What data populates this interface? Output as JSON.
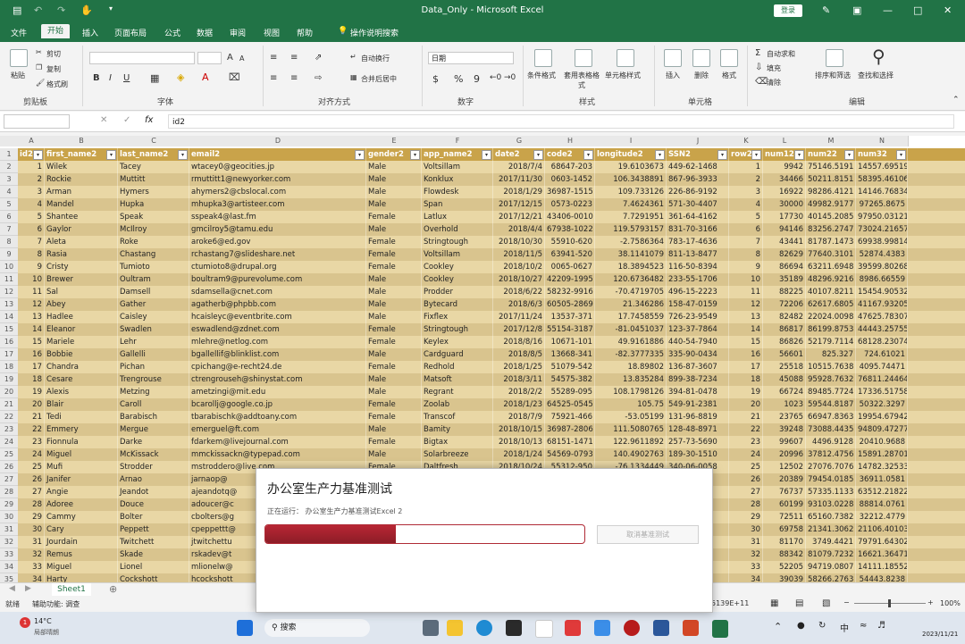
{
  "window": {
    "title": "Data_Only - Microsoft Excel",
    "login_label": "登录"
  },
  "tabs": [
    "文件",
    "开始",
    "插入",
    "页面布局",
    "公式",
    "数据",
    "审阅",
    "视图",
    "帮助",
    "操作说明搜索"
  ],
  "active_tab": "开始",
  "ribbon": {
    "clipboard": {
      "label": "剪贴板",
      "paste": "粘贴",
      "cut": "剪切",
      "copy": "复制",
      "format_painter": "格式刷"
    },
    "font": {
      "label": "字体",
      "size_up": "A",
      "size_down": "A",
      "bold": "B",
      "italic": "I",
      "underline": "U"
    },
    "alignment": {
      "label": "对齐方式",
      "wrap": "自动换行",
      "merge": "合并后居中"
    },
    "number": {
      "label": "数字",
      "format": "日期",
      "currency": "$",
      "percent": "%",
      "comma": "9"
    },
    "styles": {
      "label": "样式",
      "cond": "条件格式",
      "table": "套用表格格式",
      "cell": "单元格样式"
    },
    "cells": {
      "label": "单元格",
      "insert": "插入",
      "delete": "删除",
      "format": "格式"
    },
    "editing": {
      "label": "编辑",
      "autosum": "自动求和",
      "fill": "填充",
      "clear": "清除",
      "sort": "排序和筛选",
      "find": "查找和选择"
    }
  },
  "formula_bar": {
    "name_box": "",
    "fx": "fx",
    "value": "id2"
  },
  "columns": [
    "A",
    "B",
    "C",
    "D",
    "E",
    "F",
    "G",
    "H",
    "I",
    "J",
    "K",
    "L",
    "M",
    "N"
  ],
  "headers": [
    "id2",
    "first_name2",
    "last_name2",
    "email2",
    "gender2",
    "app_name2",
    "date2",
    "code2",
    "longitude2",
    "SSN2",
    "row2",
    "num12",
    "num22",
    "num32"
  ],
  "rows": [
    [
      "1",
      "Wilek",
      "Tacey",
      "wtacey0@geocities.jp",
      "Male",
      "Voltsillam",
      "2018/7/4",
      "68647-203",
      "19.6103673",
      "449-62-1468",
      "1",
      "9942",
      "75146.5191",
      "14557.69519"
    ],
    [
      "2",
      "Rockie",
      "Muttitt",
      "rmuttitt1@newyorker.com",
      "Male",
      "Konklux",
      "2017/11/30",
      "0603-1452",
      "106.3438891",
      "867-96-3933",
      "2",
      "34466",
      "50211.8151",
      "58395.46106"
    ],
    [
      "3",
      "Arman",
      "Hymers",
      "ahymers2@cbslocal.com",
      "Male",
      "Flowdesk",
      "2018/1/29",
      "36987-1515",
      "109.733126",
      "226-86-9192",
      "3",
      "16922",
      "98286.4121",
      "14146.76834"
    ],
    [
      "4",
      "Mandel",
      "Hupka",
      "mhupka3@artisteer.com",
      "Male",
      "Span",
      "2017/12/15",
      "0573-0223",
      "7.4624361",
      "571-30-4407",
      "4",
      "30000",
      "49982.9177",
      "97265.8675"
    ],
    [
      "5",
      "Shantee",
      "Speak",
      "sspeak4@last.fm",
      "Female",
      "Latlux",
      "2017/12/21",
      "43406-0010",
      "7.7291951",
      "361-64-4162",
      "5",
      "17730",
      "40145.2085",
      "97950.03121"
    ],
    [
      "6",
      "Gaylor",
      "McIlroy",
      "gmcilroy5@tamu.edu",
      "Male",
      "Overhold",
      "2018/4/4",
      "67938-1022",
      "119.5793157",
      "831-70-3166",
      "6",
      "94146",
      "83256.2747",
      "73024.21657"
    ],
    [
      "7",
      "Aleta",
      "Roke",
      "aroke6@ed.gov",
      "Female",
      "Stringtough",
      "2018/10/30",
      "55910-620",
      "-2.7586364",
      "783-17-4636",
      "7",
      "43441",
      "81787.1473",
      "69938.99814"
    ],
    [
      "8",
      "Rasia",
      "Chastang",
      "rchastang7@slideshare.net",
      "Female",
      "Voltsillam",
      "2018/11/5",
      "63941-520",
      "38.1141079",
      "811-13-8477",
      "8",
      "82629",
      "77640.3101",
      "52874.4383"
    ],
    [
      "9",
      "Cristy",
      "Tumioto",
      "ctumioto8@drupal.org",
      "Female",
      "Cookley",
      "2018/10/2",
      "0065-0627",
      "18.3894523",
      "116-50-8394",
      "9",
      "86694",
      "63211.6948",
      "39599.80268"
    ],
    [
      "10",
      "Brewer",
      "Oultram",
      "boultram9@purevolume.com",
      "Male",
      "Cookley",
      "2018/10/27",
      "42209-1995",
      "120.6736482",
      "233-55-1706",
      "10",
      "35189",
      "48296.9216",
      "8986.66559"
    ],
    [
      "11",
      "Sal",
      "Damsell",
      "sdamsella@cnet.com",
      "Male",
      "Prodder",
      "2018/6/22",
      "58232-9916",
      "-70.4719705",
      "496-15-2223",
      "11",
      "88225",
      "40107.8211",
      "15454.90532"
    ],
    [
      "12",
      "Abey",
      "Gather",
      "agatherb@phpbb.com",
      "Male",
      "Bytecard",
      "2018/6/3",
      "60505-2869",
      "21.346286",
      "158-47-0159",
      "12",
      "72206",
      "62617.6805",
      "41167.93205"
    ],
    [
      "13",
      "Hadlee",
      "Caisley",
      "hcaisleyc@eventbrite.com",
      "Male",
      "Fixflex",
      "2017/11/24",
      "13537-371",
      "17.7458559",
      "726-23-9549",
      "13",
      "82482",
      "22024.0098",
      "47625.78307"
    ],
    [
      "14",
      "Eleanor",
      "Swadlen",
      "eswadlend@zdnet.com",
      "Female",
      "Stringtough",
      "2017/12/8",
      "55154-3187",
      "-81.0451037",
      "123-37-7864",
      "14",
      "86817",
      "86199.8753",
      "44443.25755"
    ],
    [
      "15",
      "Mariele",
      "Lehr",
      "mlehre@netlog.com",
      "Female",
      "Keylex",
      "2018/8/16",
      "10671-101",
      "49.9161886",
      "440-54-7940",
      "15",
      "86826",
      "52179.7114",
      "68128.23074"
    ],
    [
      "16",
      "Bobbie",
      "Gallelli",
      "bgallellif@blinklist.com",
      "Male",
      "Cardguard",
      "2018/8/5",
      "13668-341",
      "-82.3777335",
      "335-90-0434",
      "16",
      "56601",
      "825.327",
      "724.61021"
    ],
    [
      "17",
      "Chandra",
      "Pichan",
      "cpichang@e-recht24.de",
      "Female",
      "Redhold",
      "2018/1/25",
      "51079-542",
      "18.89802",
      "136-87-3607",
      "17",
      "25518",
      "10515.7638",
      "4095.74471"
    ],
    [
      "18",
      "Cesare",
      "Trengrouse",
      "ctrengrouseh@shinystat.com",
      "Male",
      "Matsoft",
      "2018/3/11",
      "54575-382",
      "13.835284",
      "899-38-7234",
      "18",
      "45088",
      "95928.7632",
      "76811.24464"
    ],
    [
      "19",
      "Alexis",
      "Metzing",
      "ametzingi@mit.edu",
      "Male",
      "Regrant",
      "2018/2/2",
      "55289-095",
      "108.1798126",
      "394-81-0478",
      "19",
      "66724",
      "89485.7724",
      "17336.51758"
    ],
    [
      "20",
      "Blair",
      "Caroll",
      "bcarollj@google.co.jp",
      "Female",
      "Zoolab",
      "2018/1/23",
      "64525-0545",
      "105.75",
      "549-91-2381",
      "20",
      "1023",
      "59544.8187",
      "50322.3297"
    ],
    [
      "21",
      "Tedi",
      "Barabisch",
      "tbarabischk@addtoany.com",
      "Female",
      "Transcof",
      "2018/7/9",
      "75921-466",
      "-53.05199",
      "131-96-8819",
      "21",
      "23765",
      "66947.8363",
      "19954.67942"
    ],
    [
      "22",
      "Emmery",
      "Mergue",
      "emerguel@ft.com",
      "Male",
      "Bamity",
      "2018/10/15",
      "36987-2806",
      "111.5080765",
      "128-48-8971",
      "22",
      "39248",
      "73088.4435",
      "94809.47277"
    ],
    [
      "23",
      "Fionnula",
      "Darke",
      "fdarkem@livejournal.com",
      "Female",
      "Bigtax",
      "2018/10/13",
      "68151-1471",
      "122.9611892",
      "257-73-5690",
      "23",
      "99607",
      "4496.9128",
      "20410.9688"
    ],
    [
      "24",
      "Miguel",
      "McKissack",
      "mmckissackn@typepad.com",
      "Male",
      "Solarbreeze",
      "2018/1/24",
      "54569-0793",
      "140.4902763",
      "189-30-1510",
      "24",
      "20996",
      "37812.4756",
      "15891.28701"
    ],
    [
      "25",
      "Mufi",
      "Strodder",
      "mstroddero@live.com",
      "Female",
      "Daltfresh",
      "2018/10/24",
      "55312-950",
      "-76.1334449",
      "340-06-0058",
      "25",
      "12502",
      "27076.7076",
      "14782.32533"
    ],
    [
      "26",
      "Janifer",
      "Arnao",
      "jarnaop@",
      "",
      "",
      "",
      "",
      "",
      "-755",
      "26",
      "20389",
      "79454.0185",
      "36911.0581"
    ],
    [
      "27",
      "Angie",
      "Jeandot",
      "ajeandotq@",
      "",
      "",
      "",
      "",
      "",
      "-7854",
      "27",
      "76737",
      "57335.1133",
      "63512.21822"
    ],
    [
      "28",
      "Adoree",
      "Douce",
      "adoucer@c",
      "",
      "",
      "",
      "",
      "",
      "-0862",
      "28",
      "60199",
      "93103.0228",
      "88814.0761"
    ],
    [
      "29",
      "Cammy",
      "Bolter",
      "cbolters@g",
      "",
      "",
      "",
      "",
      "",
      "-1735",
      "29",
      "72511",
      "65160.7382",
      "32212.4779"
    ],
    [
      "30",
      "Cary",
      "Peppett",
      "cpeppettt@",
      "",
      "",
      "",
      "",
      "",
      "-5856",
      "30",
      "69758",
      "21341.3062",
      "21106.40103"
    ],
    [
      "31",
      "Jourdain",
      "Twitchett",
      "jtwitchettu",
      "",
      "",
      "",
      "",
      "",
      "-5473",
      "31",
      "81170",
      "3749.4421",
      "79791.64302"
    ],
    [
      "32",
      "Remus",
      "Skade",
      "rskadev@t",
      "",
      "",
      "",
      "",
      "",
      "-4125",
      "32",
      "88342",
      "81079.7232",
      "16621.36471"
    ],
    [
      "33",
      "Miguel",
      "Lionel",
      "mlionelw@",
      "",
      "",
      "",
      "",
      "",
      "-4286",
      "33",
      "52205",
      "94719.0807",
      "14111.18552"
    ],
    [
      "34",
      "Harty",
      "Cockshott",
      "hcockshott",
      "",
      "",
      "",
      "",
      "",
      "-1281",
      "34",
      "39039",
      "58266.2763",
      "54443.8238"
    ]
  ],
  "sheet_tab": "Sheet1",
  "status": {
    "mode": "就绪",
    "accessibility": "辅助功能: 调查",
    "readout": "5139E+11",
    "zoom": "100%"
  },
  "dialog": {
    "title": "办公室生产力基准测试",
    "subtitle": "正在运行：  办公室生产力基准测试Excel 2",
    "progress": 0.41,
    "cancel": "取消基准测试"
  },
  "taskbar": {
    "weather_temp": "14°C",
    "weather_text": "局部晴朗",
    "search": "搜索",
    "ime": "中",
    "date": "2023/11/21"
  }
}
